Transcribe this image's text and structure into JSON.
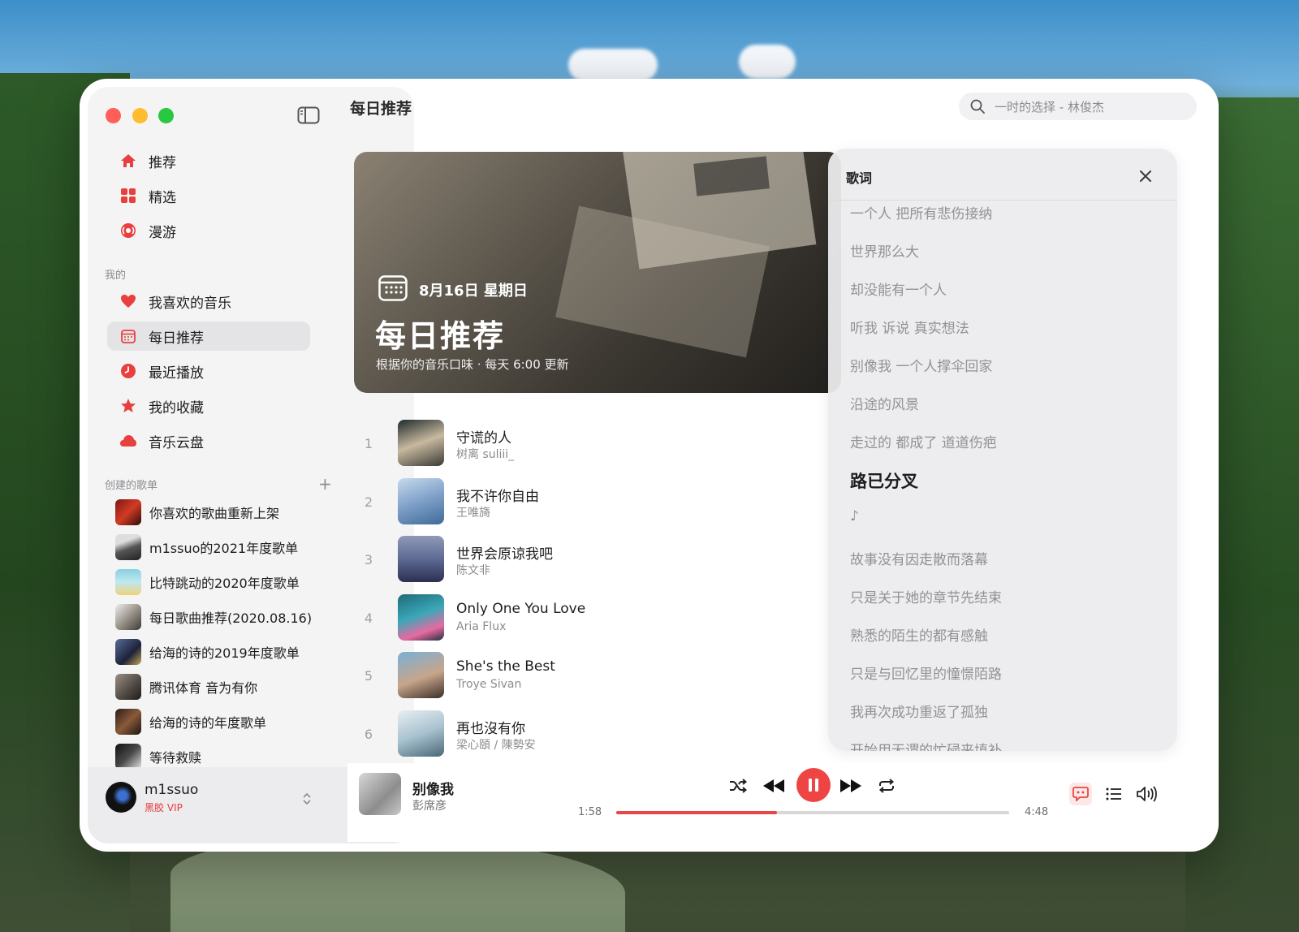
{
  "app": {
    "page_title": "每日推荐"
  },
  "search": {
    "placeholder": "一时的选择 - 林俊杰"
  },
  "nav": [
    {
      "label": "推荐",
      "icon": "home-icon"
    },
    {
      "label": "精选",
      "icon": "grid-icon"
    },
    {
      "label": "漫游",
      "icon": "radio-icon"
    }
  ],
  "mine": {
    "title": "我的",
    "items": [
      {
        "label": "我喜欢的音乐",
        "icon": "heart-icon"
      },
      {
        "label": "每日推荐",
        "icon": "calendar-icon",
        "active": true
      },
      {
        "label": "最近播放",
        "icon": "clock-icon"
      },
      {
        "label": "我的收藏",
        "icon": "star-icon"
      },
      {
        "label": "音乐云盘",
        "icon": "cloud-icon"
      }
    ]
  },
  "playlists": {
    "title": "创建的歌单",
    "add_label": "+",
    "items": [
      {
        "label": "你喜欢的歌曲重新上架"
      },
      {
        "label": "m1ssuo的2021年度歌单"
      },
      {
        "label": "比特跳动的2020年度歌单"
      },
      {
        "label": "每日歌曲推荐(2020.08.16)"
      },
      {
        "label": "给海的诗的2019年度歌单"
      },
      {
        "label": "腾讯体育 音为有你"
      },
      {
        "label": "给海的诗的年度歌单"
      },
      {
        "label": "等待救赎"
      }
    ]
  },
  "user": {
    "name": "m1ssuo",
    "vip": "黑胶 VIP"
  },
  "hero": {
    "date": "8月16日 星期日",
    "title": "每日推荐",
    "subtitle": "根据你的音乐口味 · 每天 6:00 更新"
  },
  "tracks": [
    {
      "no": "1",
      "title": "守谎的人",
      "artist": "树离 suliii_"
    },
    {
      "no": "2",
      "title": "我不许你自由",
      "artist": "王唯旖"
    },
    {
      "no": "3",
      "title": "世界会原谅我吧",
      "artist": "陈文非"
    },
    {
      "no": "4",
      "title": "Only One You Love",
      "artist": "Aria Flux"
    },
    {
      "no": "5",
      "title": "She's the Best",
      "artist": "Troye Sivan"
    },
    {
      "no": "6",
      "title": "再也沒有你",
      "artist": "梁心頤 / 陳勢安"
    }
  ],
  "lyrics": {
    "title": "歌词",
    "lines": [
      "一个人 把所有悲伤接纳",
      "世界那么大",
      "却没能有一个人",
      "听我 诉说 真实想法",
      "别像我 一个人撑伞回家",
      "沿途的风景",
      "走过的 都成了 道道伤疤",
      "路已分叉",
      "♪",
      "故事没有因走散而落幕",
      "只是关于她的章节先结束",
      "熟悉的陌生的都有感触",
      "只是与回忆里的憧憬陌路",
      "我再次成功重返了孤独",
      "开始用无谓的忙碌来填补"
    ],
    "current_index": 7
  },
  "now_playing": {
    "title": "别像我",
    "artist": "彭席彦",
    "elapsed": "1:58",
    "duration": "4:48",
    "progress": 0.41
  },
  "colors": {
    "accent": "#ef4444",
    "sidebar_bg": "#f4f4f5"
  }
}
